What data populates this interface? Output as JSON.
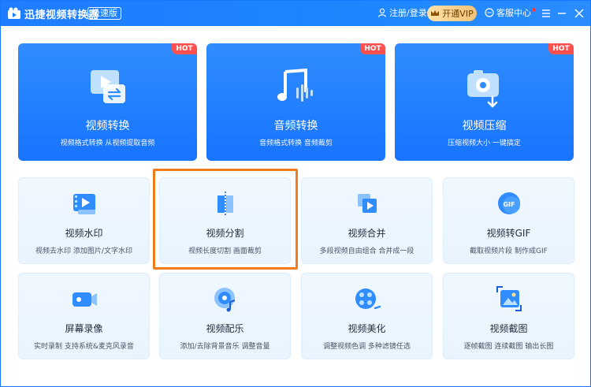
{
  "app": {
    "title": "迅捷视频转换器",
    "edition": "极速版",
    "login_label": "注册/登录",
    "vip_label": "开通VIP",
    "service_label": "客服中心"
  },
  "colors": {
    "brand": "#1f7cff",
    "hot": "#ff5050",
    "highlight": "#f07c1b"
  },
  "big_cards": [
    {
      "title": "视频转换",
      "subtitle": "视频格式转换 从视频提取音频",
      "badge": "HOT",
      "icon": "video-convert-icon"
    },
    {
      "title": "音频转换",
      "subtitle": "音频格式转换 音频裁剪",
      "badge": "HOT",
      "icon": "audio-convert-icon"
    },
    {
      "title": "视频压缩",
      "subtitle": "压缩视频大小 一键搞定",
      "badge": "HOT",
      "icon": "video-compress-icon"
    }
  ],
  "tools": [
    {
      "title": "视频水印",
      "subtitle": "视频去水印 添加图片/文字水印",
      "icon": "watermark-icon"
    },
    {
      "title": "视频分割",
      "subtitle": "视频长度切割 画面裁剪",
      "icon": "split-icon"
    },
    {
      "title": "视频合并",
      "subtitle": "多段视频自由组合 合并成一段",
      "icon": "merge-icon"
    },
    {
      "title": "视频转GIF",
      "subtitle": "截取视频片段 制作成GIF",
      "icon": "gif-icon"
    },
    {
      "title": "屏幕录像",
      "subtitle": "实时录制 支持系统&麦克风录音",
      "icon": "screen-record-icon"
    },
    {
      "title": "视频配乐",
      "subtitle": "添加/去除背景音乐 调整音量",
      "icon": "music-icon"
    },
    {
      "title": "视频美化",
      "subtitle": "调整视频色调 多种滤镜任选",
      "icon": "beautify-icon"
    },
    {
      "title": "视频截图",
      "subtitle": "逐帧截图 连续截图 输出长图",
      "icon": "screenshot-icon"
    }
  ]
}
